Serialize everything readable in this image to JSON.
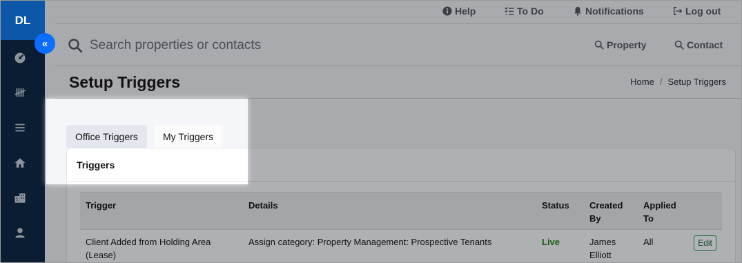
{
  "user": {
    "initials": "DL"
  },
  "sidebar": {
    "collapse_glyph": "«",
    "items": [
      {
        "icon": "dashboard-gauge-icon"
      },
      {
        "icon": "tally-marks-icon"
      },
      {
        "icon": "list-lines-icon"
      },
      {
        "icon": "home-icon"
      },
      {
        "icon": "building-icon"
      },
      {
        "icon": "person-icon"
      }
    ]
  },
  "topbar": {
    "help": "Help",
    "todo": "To Do",
    "notifications": "Notifications",
    "logout": "Log out"
  },
  "search": {
    "placeholder": "Search properties or contacts",
    "property_label": "Property",
    "contact_label": "Contact"
  },
  "page": {
    "title": "Setup Triggers",
    "breadcrumb": {
      "home": "Home",
      "separator": "/",
      "current": "Setup Triggers"
    }
  },
  "tabs": [
    {
      "label": "Office Triggers",
      "active": true
    },
    {
      "label": "My Triggers",
      "active": false
    }
  ],
  "card": {
    "title": "Triggers"
  },
  "table": {
    "headers": {
      "trigger": "Trigger",
      "details": "Details",
      "status": "Status",
      "created_by_1": "Created",
      "created_by_2": "By",
      "applied_to_1": "Applied",
      "applied_to_2": "To"
    },
    "rows": [
      {
        "trigger_1": "Client Added from Holding Area",
        "trigger_2": "(Lease)",
        "details": "Assign category: Property Management: Prospective Tenants",
        "status": "Live",
        "created_by_1": "James",
        "created_by_2": "Elliott",
        "applied_to": "All",
        "action": "Edit"
      }
    ]
  },
  "colors": {
    "sidebar_bg": "#0b1d33",
    "avatar_bg": "#0d57a8",
    "collapse_button": "#0d6efd",
    "status_live": "#1c5b12",
    "overlay_dim": "#a8aaad"
  }
}
